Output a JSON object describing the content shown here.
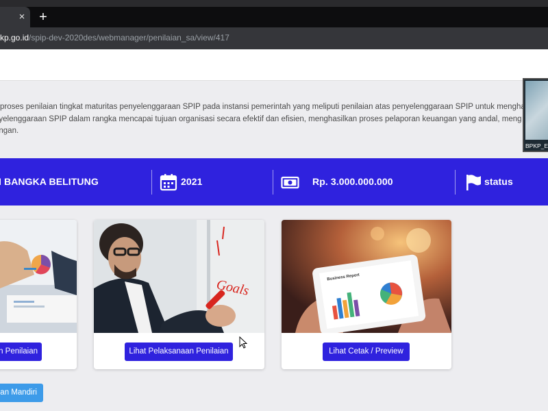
{
  "browser": {
    "tab_close": "×",
    "new_tab": "+",
    "url_host": "kp.go.id",
    "url_path": "/spip-dev-2020des/webmanager/penilaian_sa/view/417"
  },
  "intro": {
    "line1": "proses penilaian tingkat maturitas penyelenggaraan SPIP pada instansi pemerintah yang meliputi penilaian atas penyelenggaraan SPIP untuk mengha",
    "line2": "nyelenggaraan SPIP dalam rangka mencapai tujuan organisasi secara efektif dan efisien, menghasilkan proses pelaporan keuangan yang andal, meng",
    "line3": "angan."
  },
  "banner": {
    "background": "#2f22de",
    "region": "I BANGKA BELITUNG",
    "year": "2021",
    "budget": "Rp. 3.000.000.000",
    "status": "status",
    "icons": [
      "calendar-icon",
      "money-icon",
      "flag-icon"
    ]
  },
  "cards": [
    {
      "button": "n Penilaian",
      "image": "business-meeting-charts-photo"
    },
    {
      "button": "Lihat Pelaksanaan Penilaian",
      "image": "man-writing-goals-photo"
    },
    {
      "button": "Lihat Cetak / Preview",
      "image": "tablet-business-report-photo"
    }
  ],
  "mandiri_button": "an Mandiri",
  "pip": {
    "label": "BPKP_E"
  },
  "colors": {
    "primary": "#2f22de",
    "secondary_button": "#3d9be9",
    "page_bg": "#ededf0"
  }
}
